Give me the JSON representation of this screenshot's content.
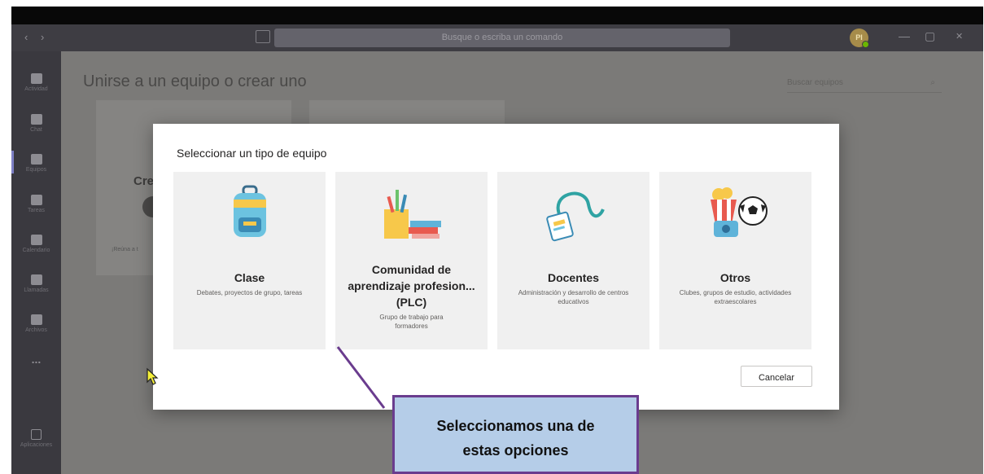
{
  "titlebar": {
    "nav_back": "‹",
    "nav_forward": "›",
    "search_placeholder": "Busque o escriba un comando",
    "avatar_initials": "PI",
    "minimize": "—",
    "maximize": "▢",
    "close": "✕"
  },
  "rail": {
    "items": [
      {
        "label": "Actividad",
        "icon": "bell-icon"
      },
      {
        "label": "Chat",
        "icon": "chat-icon"
      },
      {
        "label": "Equipos",
        "icon": "teams-icon"
      },
      {
        "label": "Tareas",
        "icon": "tasks-icon"
      },
      {
        "label": "Calendario",
        "icon": "calendar-icon"
      },
      {
        "label": "Llamadas",
        "icon": "phone-icon"
      },
      {
        "label": "Archivos",
        "icon": "files-icon"
      },
      {
        "label": "...",
        "icon": "more-icon"
      },
      {
        "label": "Aplicaciones",
        "icon": "apps-icon"
      }
    ]
  },
  "main": {
    "heading": "Unirse a un equipo o crear uno",
    "find_teams_placeholder": "Buscar equipos",
    "create_card_fragment": "Cre",
    "create_card_subfragment": "¡Reúna a t"
  },
  "modal": {
    "title": "Seleccionar un tipo de equipo",
    "tiles": [
      {
        "title": "Clase",
        "description": "Debates, proyectos de grupo, tareas",
        "icon": "backpack-icon"
      },
      {
        "title": "Comunidad de aprendizaje profesion... (PLC)",
        "title_lines": [
          "Comunidad de",
          "aprendizaje profesion...",
          "(PLC)"
        ],
        "description": "Grupo de trabajo para formadores",
        "icon": "books-icon"
      },
      {
        "title": "Docentes",
        "description": "Administración y desarrollo de centros educativos",
        "icon": "lanyard-icon"
      },
      {
        "title": "Otros",
        "description": "Clubes, grupos de estudio, actividades extraescolares",
        "icon": "popcorn-ball-icon"
      }
    ],
    "cancel_label": "Cancelar"
  },
  "callout": {
    "text": "Seleccionamos una de estas opciones",
    "line1": "Seleccionamos una de",
    "line2": "estas opciones"
  },
  "colors": {
    "accent": "#6264a7",
    "callout_fill": "#b5cde8",
    "callout_border": "#6a3c8e"
  }
}
